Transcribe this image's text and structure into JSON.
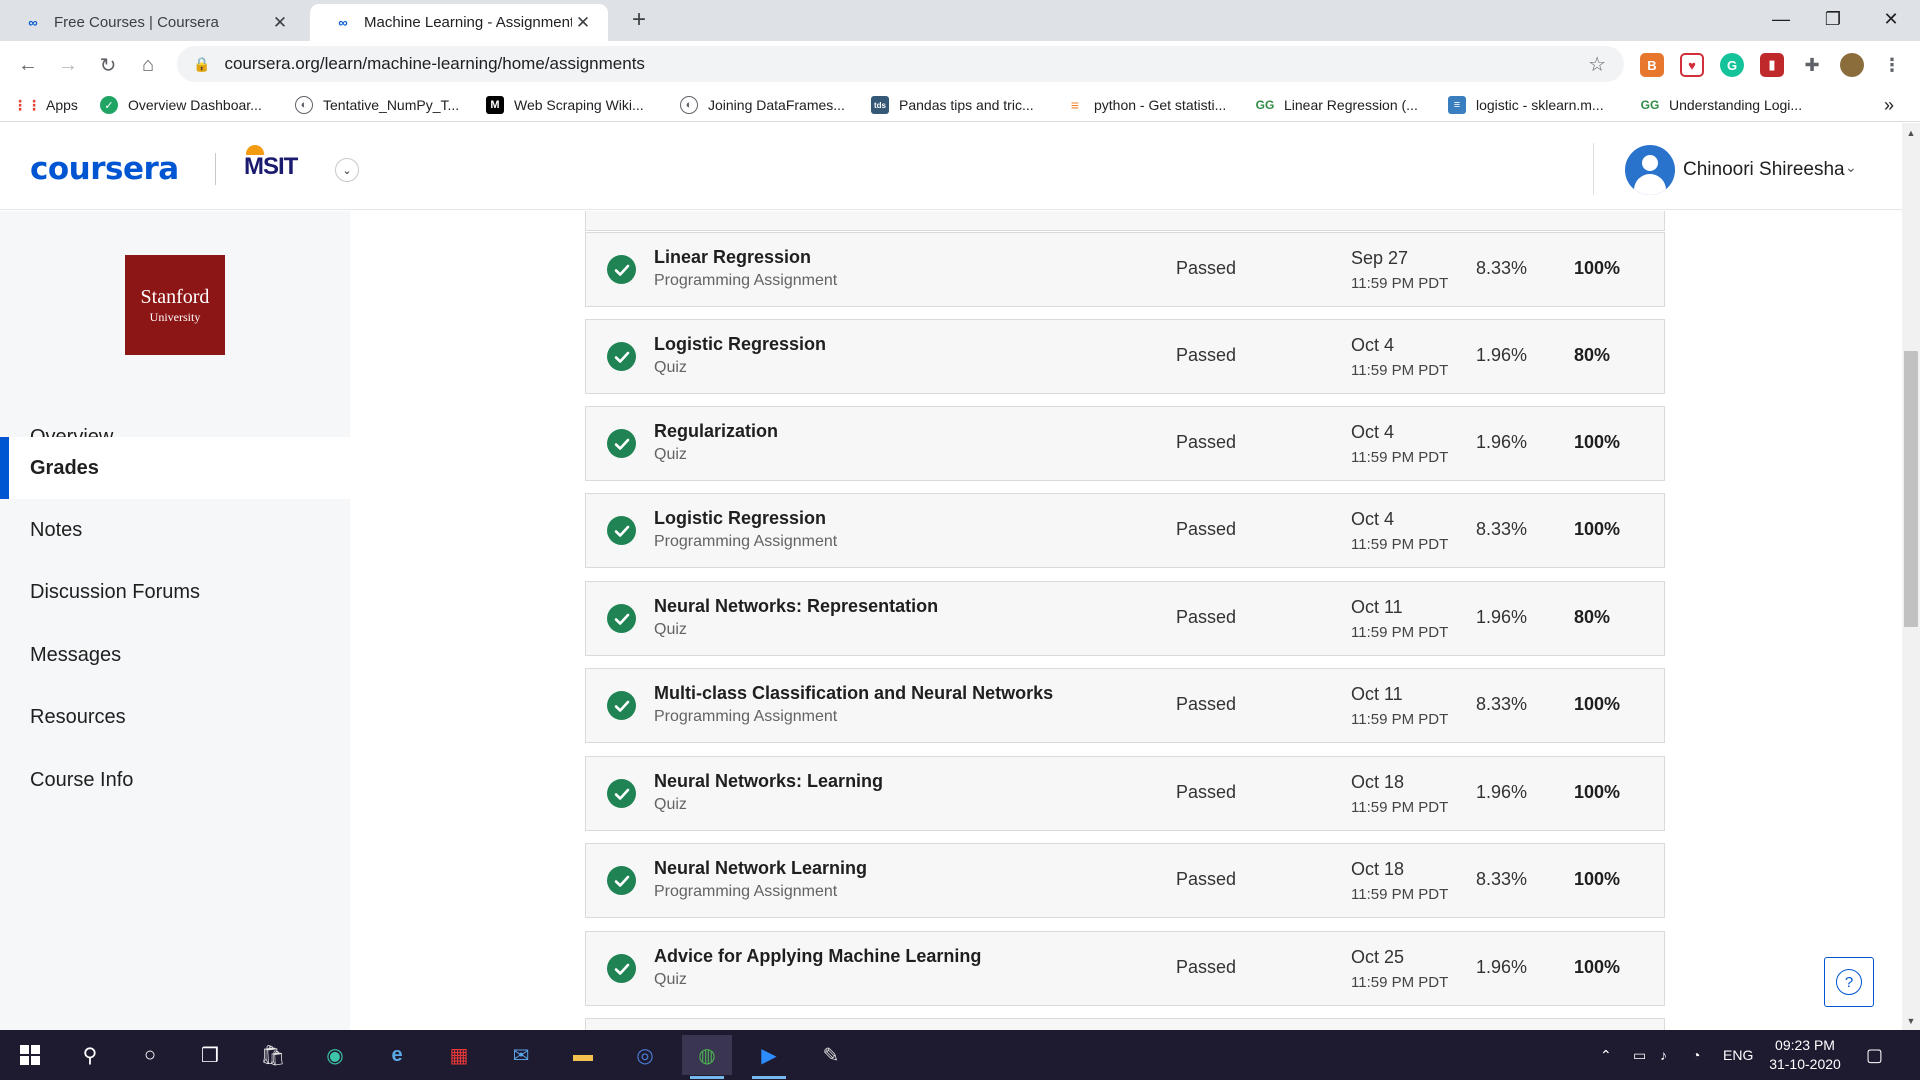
{
  "browser": {
    "tabs": [
      {
        "title": "Free Courses | Coursera"
      },
      {
        "title": "Machine Learning - Assignments"
      }
    ],
    "url": "coursera.org/learn/machine-learning/home/assignments",
    "bookmarks": [
      {
        "label": "Apps",
        "icon": "apps-grid-icon"
      },
      {
        "label": "Overview Dashboar...",
        "icon": "shield-icon"
      },
      {
        "label": "Tentative_NumPy_T...",
        "icon": "globe-icon"
      },
      {
        "label": "Web Scraping Wiki...",
        "icon": "medium-icon"
      },
      {
        "label": "Joining DataFrames...",
        "icon": "globe-icon"
      },
      {
        "label": "Pandas tips and tric...",
        "icon": "tds-icon"
      },
      {
        "label": "python - Get statisti...",
        "icon": "stackoverflow-icon"
      },
      {
        "label": "Linear Regression (...",
        "icon": "geeksforgeeks-icon"
      },
      {
        "label": "logistic - sklearn.m...",
        "icon": "stackexchange-icon"
      },
      {
        "label": "Understanding Logi...",
        "icon": "geeksforgeeks-icon"
      }
    ],
    "more_bookmarks": "»"
  },
  "header": {
    "logo": "coursera",
    "org_logo": "MSIT",
    "user_name": "Chinoori Shireesha"
  },
  "sidebar": {
    "university": {
      "name": "Stanford",
      "subtitle": "University"
    },
    "items": [
      {
        "label": "Overview"
      },
      {
        "label": "Grades"
      },
      {
        "label": "Notes"
      },
      {
        "label": "Discussion Forums"
      },
      {
        "label": "Messages"
      },
      {
        "label": "Resources"
      },
      {
        "label": "Course Info"
      }
    ],
    "active": "Grades"
  },
  "assignments": [
    {
      "name": "Linear Regression",
      "type": "Programming Assignment",
      "status": "Passed",
      "due": "Sep 27",
      "due_time": "11:59 PM PDT",
      "weight": "8.33%",
      "grade": "100%"
    },
    {
      "name": "Logistic Regression",
      "type": "Quiz",
      "status": "Passed",
      "due": "Oct 4",
      "due_time": "11:59 PM PDT",
      "weight": "1.96%",
      "grade": "80%"
    },
    {
      "name": "Regularization",
      "type": "Quiz",
      "status": "Passed",
      "due": "Oct 4",
      "due_time": "11:59 PM PDT",
      "weight": "1.96%",
      "grade": "100%"
    },
    {
      "name": "Logistic Regression",
      "type": "Programming Assignment",
      "status": "Passed",
      "due": "Oct 4",
      "due_time": "11:59 PM PDT",
      "weight": "8.33%",
      "grade": "100%"
    },
    {
      "name": "Neural Networks: Representation",
      "type": "Quiz",
      "status": "Passed",
      "due": "Oct 11",
      "due_time": "11:59 PM PDT",
      "weight": "1.96%",
      "grade": "80%"
    },
    {
      "name": "Multi-class Classification and Neural Networks",
      "type": "Programming Assignment",
      "status": "Passed",
      "due": "Oct 11",
      "due_time": "11:59 PM PDT",
      "weight": "8.33%",
      "grade": "100%"
    },
    {
      "name": "Neural Networks: Learning",
      "type": "Quiz",
      "status": "Passed",
      "due": "Oct 18",
      "due_time": "11:59 PM PDT",
      "weight": "1.96%",
      "grade": "100%"
    },
    {
      "name": "Neural Network Learning",
      "type": "Programming Assignment",
      "status": "Passed",
      "due": "Oct 18",
      "due_time": "11:59 PM PDT",
      "weight": "8.33%",
      "grade": "100%"
    },
    {
      "name": "Advice for Applying Machine Learning",
      "type": "Quiz",
      "status": "Passed",
      "due": "Oct 25",
      "due_time": "11:59 PM PDT",
      "weight": "1.96%",
      "grade": "100%"
    }
  ],
  "help": {
    "label": "?"
  },
  "taskbar": {
    "language": "ENG",
    "time": "09:23 PM",
    "date": "31-10-2020"
  },
  "colors": {
    "brand": "#0056d2",
    "check": "#1f8354",
    "stanford": "#8c1515",
    "taskbar": "#1e1a30"
  }
}
